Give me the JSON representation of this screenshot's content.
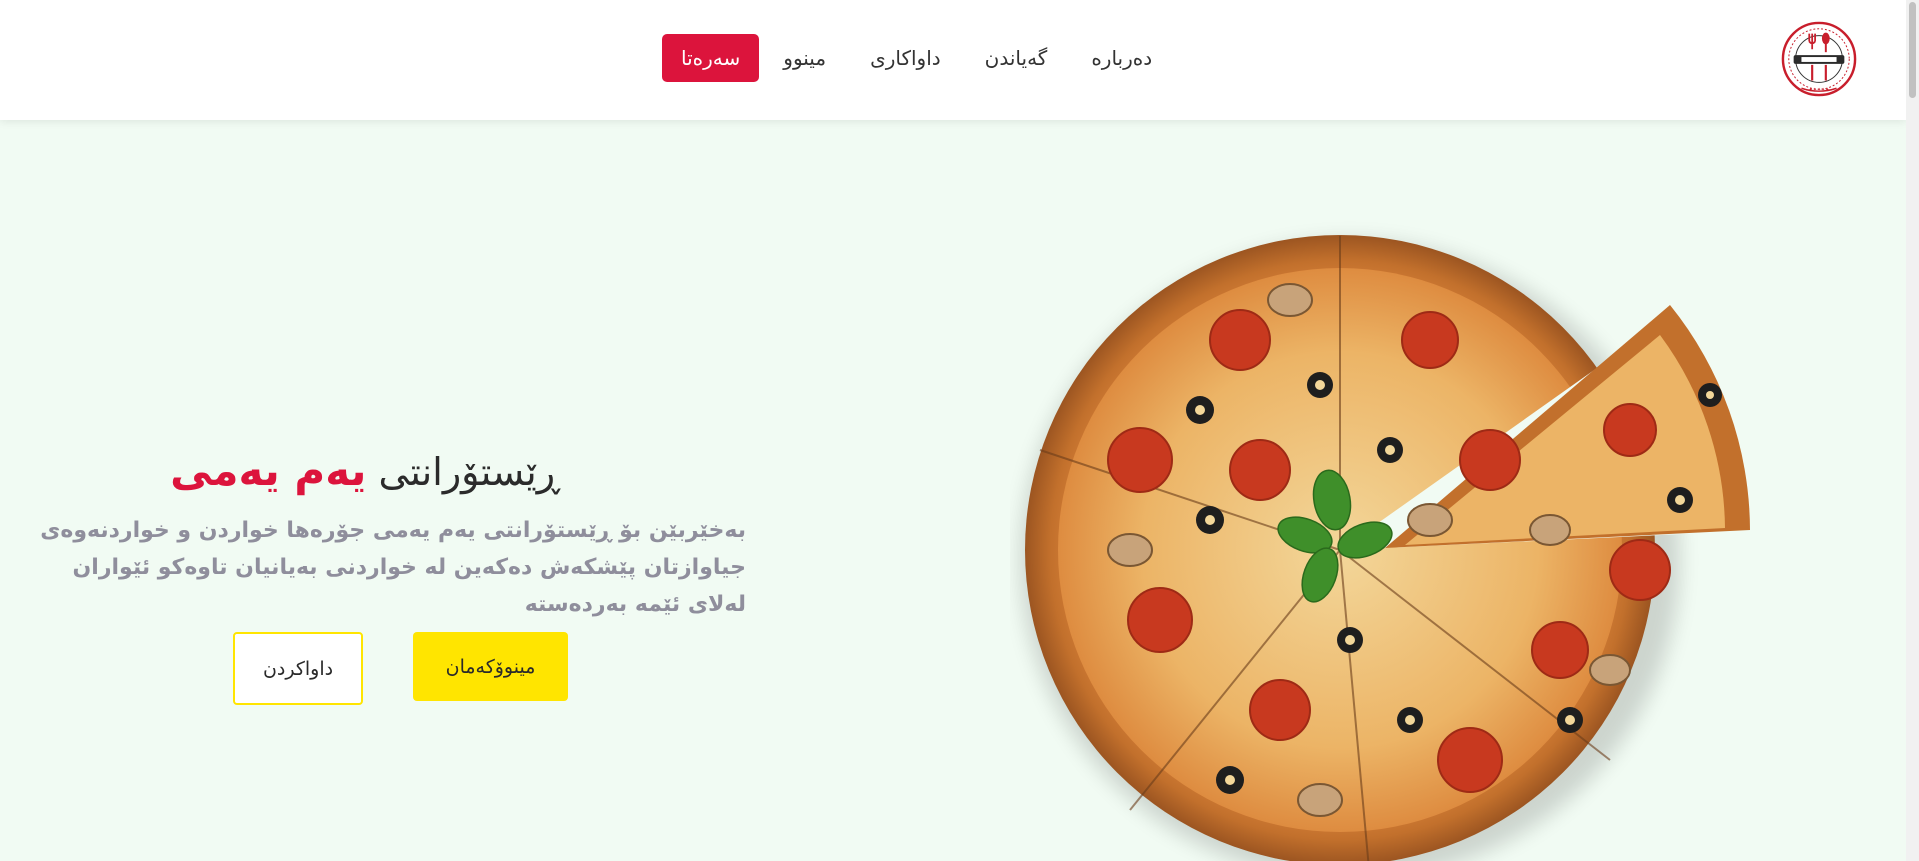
{
  "nav": {
    "links": [
      {
        "label": "سەرەتا",
        "active": true
      },
      {
        "label": "مینوو",
        "active": false
      },
      {
        "label": "داواکاری",
        "active": false
      },
      {
        "label": "گەیاندن",
        "active": false
      },
      {
        "label": "دەربارە",
        "active": false
      }
    ],
    "active_color": "#dc143c"
  },
  "hero": {
    "title_prefix": "ڕێستۆرانتی",
    "title_accent": "یەم یەمی",
    "description": "بەخێربێن بۆ ڕێستۆرانتی یەم یەمی جۆرەها خواردن و خواردنەوەی جیاوازتان پێشکەش دەکەین لە خواردنی بەیانیان تاوەکو ئێواران لەلای ئێمە بەردەستە",
    "menu_button": "مینوۆکەمان",
    "order_button": "داواکردن"
  },
  "colors": {
    "accent": "#dc143c",
    "button_yellow": "#ffe500",
    "background": "#f1fbf3"
  },
  "icons": {
    "logo": "restaurant-logo"
  }
}
